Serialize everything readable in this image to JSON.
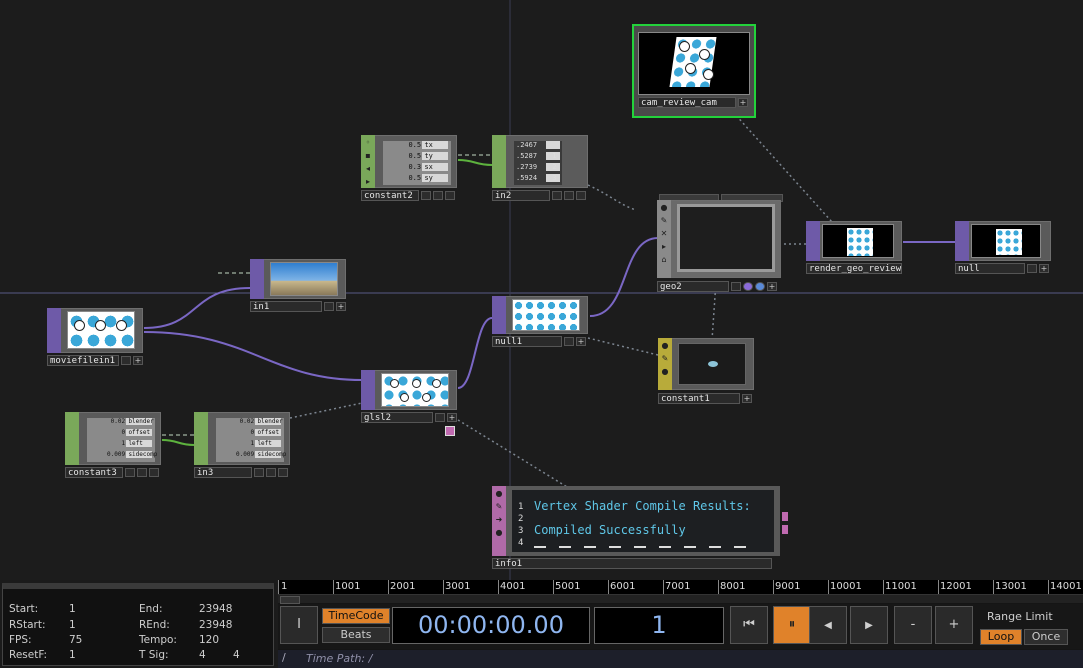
{
  "nodes": {
    "cam_review_cam": "cam_review_cam",
    "constant2": "constant2",
    "in2": "in2",
    "geo2": "geo2",
    "render_geo_review": "render_geo_review",
    "null": "null",
    "in1": "in1",
    "moviefilein1": "moviefilein1",
    "null1": "null1",
    "constant1": "constant1",
    "glsl2": "glsl2",
    "constant3": "constant3",
    "in3": "in3",
    "info1": "info1"
  },
  "constant2_rows": [
    {
      "v": "0.5",
      "k": "tx"
    },
    {
      "v": "0.5",
      "k": "ty"
    },
    {
      "v": "0.3",
      "k": "sx"
    },
    {
      "v": "0.5",
      "k": "sy"
    }
  ],
  "in2_rows": [
    {
      "v": ".2467",
      "k": "_"
    },
    {
      "v": ".5287",
      "k": "_1"
    },
    {
      "v": ".2739",
      "k": "_2"
    },
    {
      "v": ".5924",
      "k": "_3"
    }
  ],
  "constant3_rows": [
    {
      "v": "0.02",
      "k": "blender"
    },
    {
      "v": "0",
      "k": "offset"
    },
    {
      "v": "1",
      "k": "left"
    },
    {
      "v": "0.009",
      "k": "sidecomp"
    }
  ],
  "in3_rows": [
    {
      "v": "0.02",
      "k": "blender"
    },
    {
      "v": "0",
      "k": "offset"
    },
    {
      "v": "1",
      "k": "left"
    },
    {
      "v": "0.009",
      "k": "sidecomp"
    }
  ],
  "textport": {
    "line_numbers": [
      "1",
      "2",
      "3",
      "4"
    ],
    "line1": "Vertex Shader Compile Results:",
    "line3": "Compiled Successfully"
  },
  "info": {
    "start_label": "Start:",
    "start": "1",
    "end_label": "End:",
    "end": "23948",
    "rstart_label": "RStart:",
    "rstart": "1",
    "rend_label": "REnd:",
    "rend": "23948",
    "fps_label": "FPS:",
    "fps": "75",
    "tempo_label": "Tempo:",
    "tempo": "120",
    "resetf_label": "ResetF:",
    "resetf": "1",
    "tsig_label": "T Sig:",
    "tsig_a": "4",
    "tsig_b": "4"
  },
  "ruler": [
    "1",
    "1001",
    "2001",
    "3001",
    "4001",
    "5001",
    "6001",
    "7001",
    "8001",
    "9001",
    "10001",
    "11001",
    "12001",
    "13001",
    "14001"
  ],
  "transport": {
    "mode_button": "I",
    "timecode_label": "TimeCode",
    "beats_label": "Beats",
    "timecode": "00:00:00.00",
    "frame": "1",
    "range_limit_label": "Range Limit",
    "loop_label": "Loop",
    "once_label": "Once",
    "minus_label": "-",
    "plus_label": "+"
  },
  "path_bar": {
    "slash": "/",
    "text": "Time Path: /"
  },
  "colors": {
    "top_green": "#6fa64a",
    "chop_green": "#7aa85a",
    "top_purple": "#6e5aa8",
    "mat_yellow": "#b8ab3a",
    "dat_pink": "#b06aa8",
    "wire_purple": "#7a67c4",
    "wire_green": "#5db23e",
    "accent_orange": "#e0822a",
    "selected_border": "#23d23b"
  }
}
